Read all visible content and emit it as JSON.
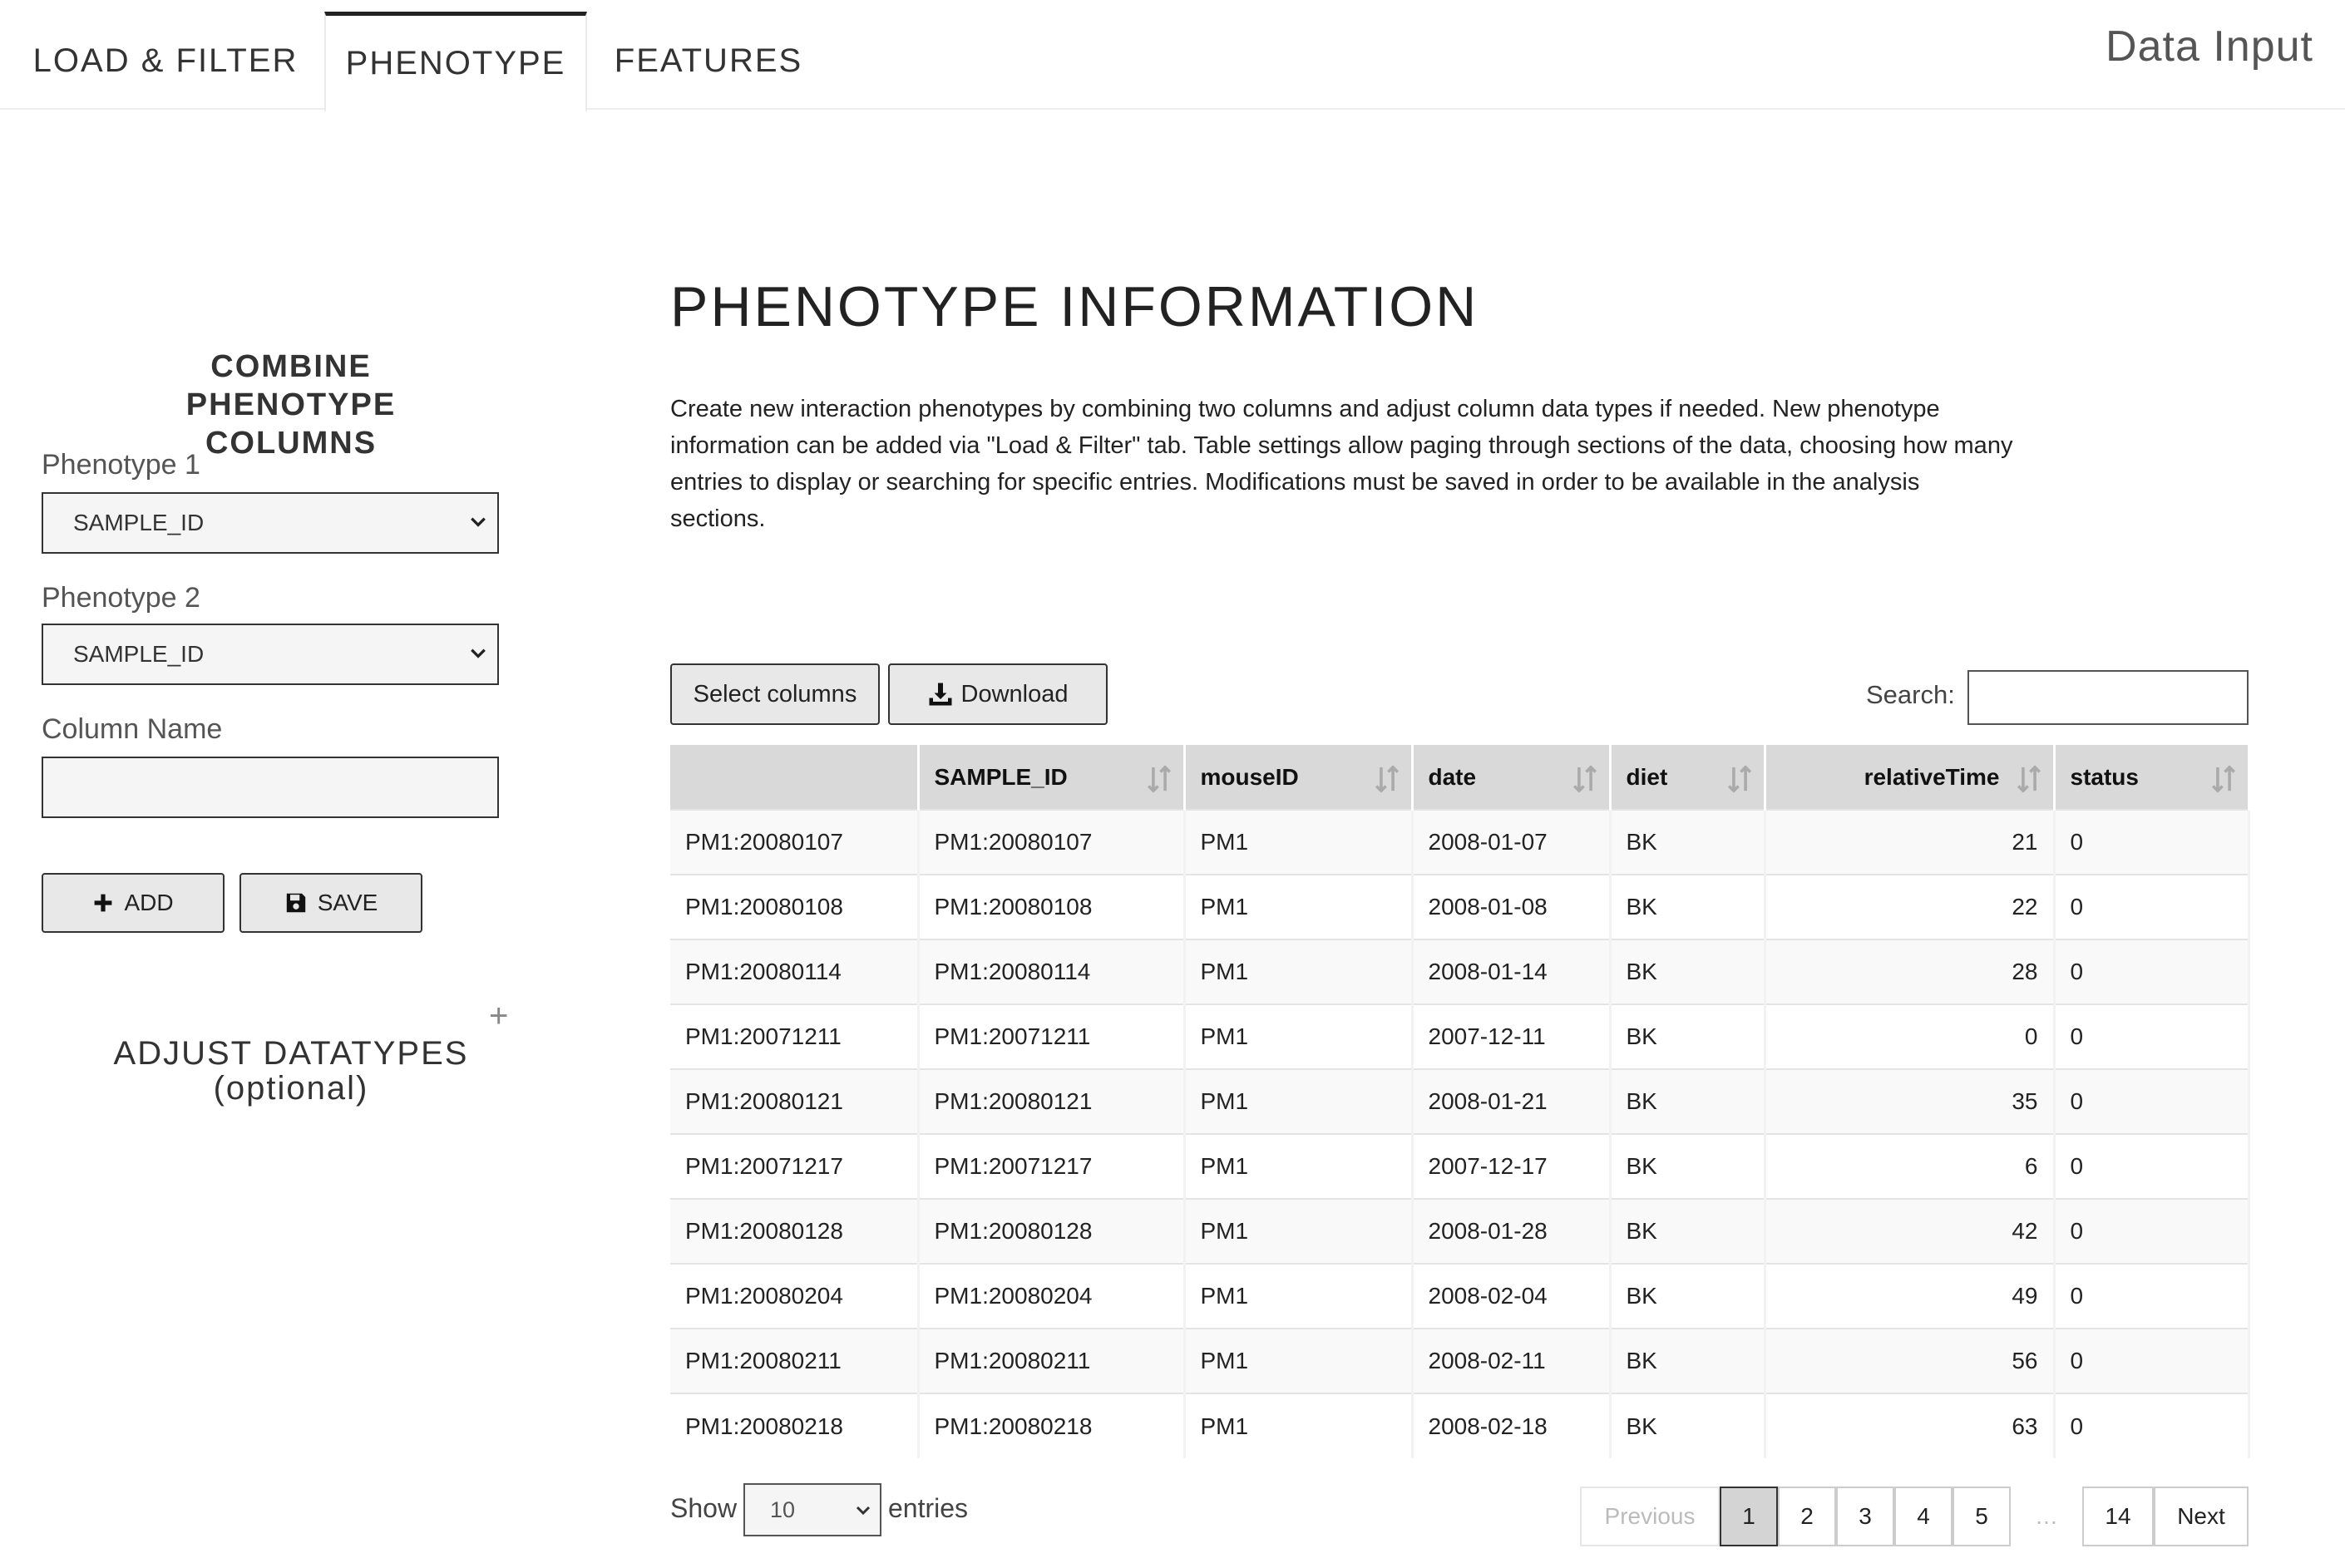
{
  "nav": {
    "tabs": [
      {
        "label": "LOAD & FILTER"
      },
      {
        "label": "PHENOTYPE"
      },
      {
        "label": "FEATURES"
      }
    ],
    "brand": "Data Input"
  },
  "left": {
    "title": "COMBINE PHENOTYPE COLUMNS",
    "phenotype1_label": "Phenotype 1",
    "phenotype1_value": "SAMPLE_ID",
    "phenotype2_label": "Phenotype 2",
    "phenotype2_value": "SAMPLE_ID",
    "column_name_label": "Column Name",
    "column_name_value": "",
    "add_label": "ADD",
    "save_label": "SAVE",
    "adjust_title": "ADJUST DATATYPES",
    "adjust_subtitle": "(optional)",
    "expand_symbol": "+"
  },
  "main": {
    "title": "PHENOTYPE INFORMATION",
    "description": "Create new interaction phenotypes by combining two columns and adjust column data types if needed. New phenotype information can be added via \"Load & Filter\" tab. Table settings allow paging through sections of the data, choosing how many entries to display or searching for specific entries. Modifications must be saved in order to be available in the analysis sections."
  },
  "table": {
    "select_columns_label": "Select columns",
    "download_label": "Download",
    "search_label": "Search:",
    "search_value": "",
    "columns": [
      "",
      "SAMPLE_ID",
      "mouseID",
      "date",
      "diet",
      "relativeTime",
      "status"
    ],
    "rows": [
      [
        "PM1:20080107",
        "PM1:20080107",
        "PM1",
        "2008-01-07",
        "BK",
        "21",
        "0"
      ],
      [
        "PM1:20080108",
        "PM1:20080108",
        "PM1",
        "2008-01-08",
        "BK",
        "22",
        "0"
      ],
      [
        "PM1:20080114",
        "PM1:20080114",
        "PM1",
        "2008-01-14",
        "BK",
        "28",
        "0"
      ],
      [
        "PM1:20071211",
        "PM1:20071211",
        "PM1",
        "2007-12-11",
        "BK",
        "0",
        "0"
      ],
      [
        "PM1:20080121",
        "PM1:20080121",
        "PM1",
        "2008-01-21",
        "BK",
        "35",
        "0"
      ],
      [
        "PM1:20071217",
        "PM1:20071217",
        "PM1",
        "2007-12-17",
        "BK",
        "6",
        "0"
      ],
      [
        "PM1:20080128",
        "PM1:20080128",
        "PM1",
        "2008-01-28",
        "BK",
        "42",
        "0"
      ],
      [
        "PM1:20080204",
        "PM1:20080204",
        "PM1",
        "2008-02-04",
        "BK",
        "49",
        "0"
      ],
      [
        "PM1:20080211",
        "PM1:20080211",
        "PM1",
        "2008-02-11",
        "BK",
        "56",
        "0"
      ],
      [
        "PM1:20080218",
        "PM1:20080218",
        "PM1",
        "2008-02-18",
        "BK",
        "63",
        "0"
      ]
    ],
    "show_label": "Show",
    "page_length": "10",
    "entries_label": "entries"
  },
  "pagination": {
    "previous": "Previous",
    "pages": [
      "1",
      "2",
      "3",
      "4",
      "5"
    ],
    "ellipsis": "…",
    "last": "14",
    "next": "Next",
    "current": "1"
  },
  "colors": {
    "header_bg": "#d9d9d9",
    "button_bg": "#e8e8e8",
    "current_page_bg": "#d4d4d4"
  }
}
